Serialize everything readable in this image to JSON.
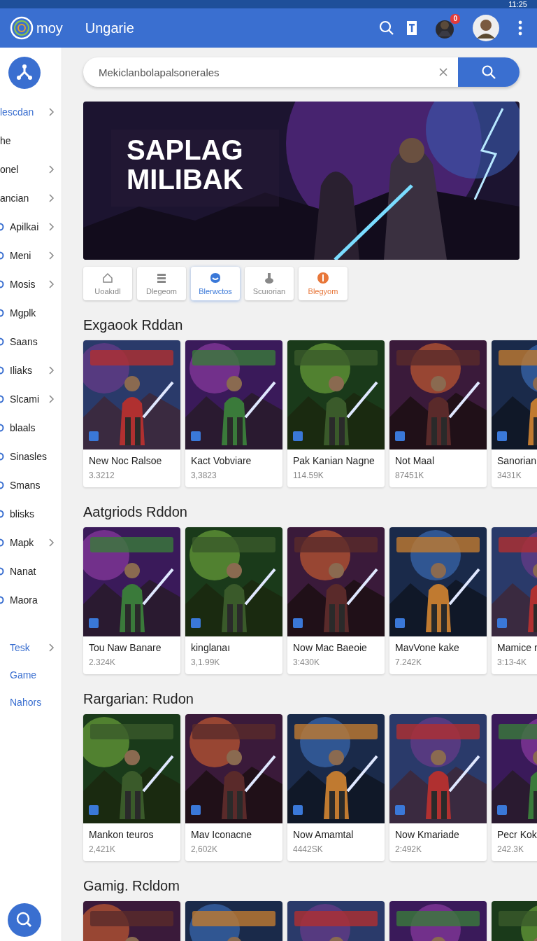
{
  "status_bar": {
    "time": "11:25"
  },
  "header": {
    "logo_text": "moy",
    "title": "Ungarie",
    "notification_count": "0"
  },
  "sidebar": {
    "items": [
      {
        "label": "lescdan",
        "kind": "active",
        "chevron": true,
        "icon": false
      },
      {
        "label": "he",
        "kind": "item",
        "chevron": false,
        "icon": false
      },
      {
        "label": "onel",
        "kind": "item",
        "chevron": true,
        "icon": false
      },
      {
        "label": "ancian",
        "kind": "item",
        "chevron": true,
        "icon": false
      },
      {
        "label": "Apilkai",
        "kind": "item",
        "chevron": true,
        "icon": true
      },
      {
        "label": "Meni",
        "kind": "item",
        "chevron": true,
        "icon": true
      },
      {
        "label": "Mosis",
        "kind": "item",
        "chevron": true,
        "icon": true
      },
      {
        "label": "Mgplk",
        "kind": "item",
        "chevron": false,
        "icon": true
      },
      {
        "label": "Saans",
        "kind": "item",
        "chevron": false,
        "icon": true
      },
      {
        "label": "Iliaks",
        "kind": "item",
        "chevron": true,
        "icon": true
      },
      {
        "label": "Slcami",
        "kind": "item",
        "chevron": true,
        "icon": true
      },
      {
        "label": "blaals",
        "kind": "item",
        "chevron": false,
        "icon": true
      },
      {
        "label": "Sinasles",
        "kind": "item",
        "chevron": false,
        "icon": true
      },
      {
        "label": "Smans",
        "kind": "item",
        "chevron": false,
        "icon": true
      },
      {
        "label": "blisks",
        "kind": "item",
        "chevron": false,
        "icon": true
      },
      {
        "label": "Mapk",
        "kind": "item",
        "chevron": true,
        "icon": true
      },
      {
        "label": "Nanat",
        "kind": "item",
        "chevron": false,
        "icon": true
      },
      {
        "label": "Maora",
        "kind": "item",
        "chevron": false,
        "icon": true
      }
    ],
    "links": [
      {
        "label": "Tesk",
        "chevron": true
      },
      {
        "label": "Game",
        "chevron": false
      },
      {
        "label": "Nahors",
        "chevron": false
      }
    ]
  },
  "search": {
    "value": "Mekiclanbolapalsonerales"
  },
  "banner": {
    "title": "SAPLAG MILIBAK"
  },
  "categories": [
    {
      "label": "Uoakıdl",
      "selected": false,
      "color": "#888888"
    },
    {
      "label": "Dlegeom",
      "selected": false,
      "color": "#888888"
    },
    {
      "label": "Blerwctos",
      "selected": true,
      "color": "#3a78d8"
    },
    {
      "label": "Scuıorian",
      "selected": false,
      "color": "#888888"
    },
    {
      "label": "Blegyom",
      "selected": false,
      "color": "#e8773a"
    }
  ],
  "sections": [
    {
      "title": "Exgaook Rddan",
      "games": [
        {
          "kind": "card",
          "title": "New Noc Ralsoe",
          "count": "3.3212"
        },
        {
          "kind": "card",
          "title": "Kact Vobviare",
          "count": "3,3823"
        },
        {
          "kind": "card",
          "title": "Pak Kanian Nagne",
          "count": "114.59K"
        },
        {
          "kind": "card",
          "title": "Not Maal",
          "count": "87451K"
        },
        {
          "kind": "card",
          "title": "Sanorian",
          "count": "3431K"
        }
      ]
    },
    {
      "title": "Aatgriods Rddon",
      "games": [
        {
          "kind": "card",
          "title": "Tou Naw Banare",
          "count": "2.324K"
        },
        {
          "kind": "card",
          "title": "kinglanaı",
          "count": "3,1.99K"
        },
        {
          "kind": "card",
          "title": "Now Mac Baeoie",
          "count": "3:430K"
        },
        {
          "kind": "card",
          "title": "MavVone kake",
          "count": "7.242K"
        },
        {
          "kind": "card",
          "title": "Mamice r",
          "count": "3:13-4K"
        }
      ]
    },
    {
      "title": "Rargarian: Rudon",
      "games": [
        {
          "kind": "card",
          "title": "Mankon teuros",
          "count": "2,421K"
        },
        {
          "kind": "card",
          "title": "Mav Iconacne",
          "count": "2,602K"
        },
        {
          "kind": "card",
          "title": "Now Amamtal",
          "count": "4442SK"
        },
        {
          "kind": "card",
          "title": "Now Kmariade",
          "count": "2:492K"
        },
        {
          "kind": "card",
          "title": "Pecr Kok",
          "count": "242.3K"
        }
      ]
    },
    {
      "title": "Gamig. Rcldom"
    }
  ]
}
